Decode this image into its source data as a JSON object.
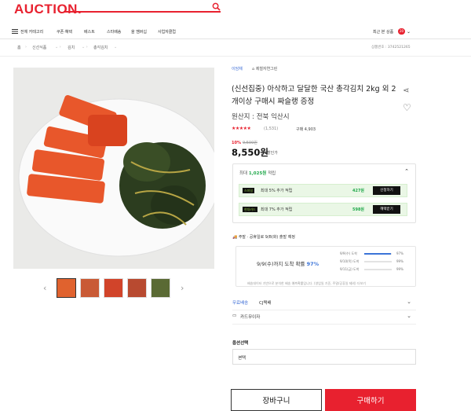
{
  "header": {
    "logo": "AUCTION."
  },
  "nav": {
    "menu": "전체 카테고리",
    "items": [
      "쿠폰·혜택",
      "베스트",
      "스타배송",
      "올 멤버십",
      "사업자클럽"
    ],
    "recent_label": "최근 본 상품",
    "recent_count": "20"
  },
  "breadcrumb": {
    "items": [
      "홈",
      "신선식품",
      "김치",
      "총각김치"
    ],
    "product_no": "상품번호 : 3742521265"
  },
  "product": {
    "seller": "이담채",
    "store": "제철자연그린",
    "title": "(신선집중) 아삭하고 달달한 국산 총각김치 2kg 외 2개이상 구매시 짜슬랭 증정",
    "origin": "원산지 : 전북 익산시",
    "stars": "★★★★★",
    "rating_count": "(1,531)",
    "purchases": "구매 4,903",
    "discount_pct": "10%",
    "original_price": "9,500원",
    "price": "8,550원",
    "price_note": "할인가"
  },
  "benefit": {
    "title_prefix": "최대 ",
    "title_amount": "1,025원",
    "title_suffix": " 적립",
    "rows": [
      {
        "tag": "스마일",
        "text": "최대 5% 추가 적립",
        "amount": "427원",
        "button": "신청하기"
      },
      {
        "tag": "현대카드",
        "text": "최대 7% 추가 적립",
        "amount": "598원",
        "button": "혜택받기"
      }
    ]
  },
  "shipping": {
    "line": "주말 · 공휴일로 9/8(화) 출발 예정",
    "estimate_prefix": "9/9(수)까지 도착 확률 ",
    "estimate_pct": "97%",
    "rows": [
      {
        "label": "9/9(수) 도착",
        "pct": "97%",
        "fill": 0.97
      },
      {
        "label": "9/10(목) 도착",
        "pct": "99%",
        "fill": 0.99
      },
      {
        "label": "9/11(금) 도착",
        "pct": "99%",
        "fill": 0.99
      }
    ],
    "note": "배송데이터 기반으로 분석한 배송 예측확률입니다. (영업일 기준, 주말/공휴일 제외) 더보기"
  },
  "delivery": {
    "free": "무료배송",
    "carrier": "CJ택배"
  },
  "card": {
    "label": "카드무이자"
  },
  "option": {
    "title": "옵션선택",
    "placeholder": "선택"
  },
  "actions": {
    "cart": "장바구니",
    "buy": "구매하기"
  },
  "colors": {
    "brand": "#e8212f",
    "accent_green": "#1fa84a",
    "blue": "#3b74d8"
  }
}
